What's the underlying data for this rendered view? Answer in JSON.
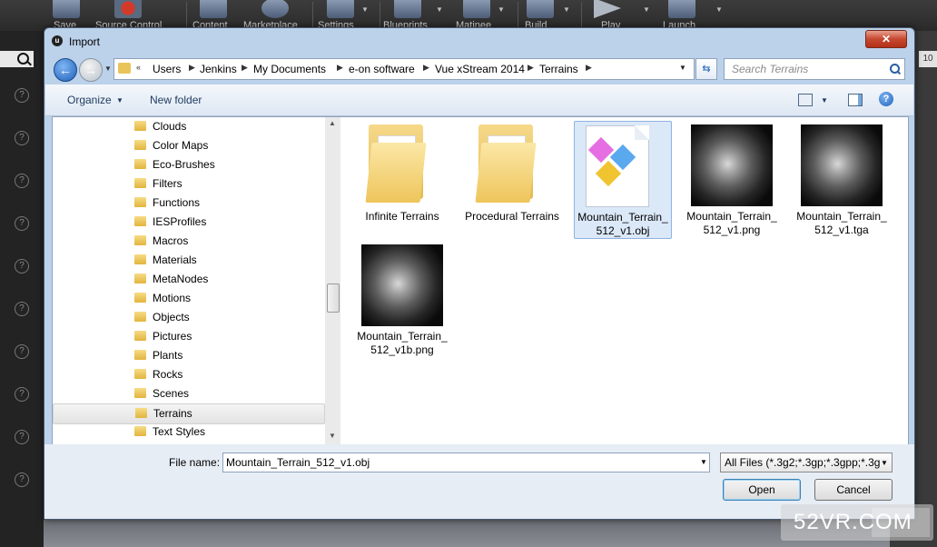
{
  "app_toolbar": {
    "items": [
      {
        "label": "Save"
      },
      {
        "label": "Source Control"
      },
      {
        "label": "Content"
      },
      {
        "label": "Marketplace"
      },
      {
        "label": "Settings"
      },
      {
        "label": "Blueprints"
      },
      {
        "label": "Matinee"
      },
      {
        "label": "Build"
      },
      {
        "label": "Play"
      },
      {
        "label": "Launch"
      }
    ],
    "right_value": "10"
  },
  "dialog": {
    "title": "Import",
    "close_glyph": "✕",
    "breadcrumbs": [
      "Users",
      "Jenkins",
      "My Documents",
      "e-on software",
      "Vue xStream 2014",
      "Terrains"
    ],
    "search_placeholder": "Search Terrains",
    "commands": {
      "organize": "Organize",
      "new_folder": "New folder"
    },
    "folders": [
      {
        "label": "Clouds"
      },
      {
        "label": "Color Maps"
      },
      {
        "label": "Eco-Brushes"
      },
      {
        "label": "Filters"
      },
      {
        "label": "Functions"
      },
      {
        "label": "IESProfiles"
      },
      {
        "label": "Macros"
      },
      {
        "label": "Materials"
      },
      {
        "label": "MetaNodes"
      },
      {
        "label": "Motions"
      },
      {
        "label": "Objects"
      },
      {
        "label": "Pictures"
      },
      {
        "label": "Plants"
      },
      {
        "label": "Rocks"
      },
      {
        "label": "Scenes"
      },
      {
        "label": "Terrains",
        "selected": true
      },
      {
        "label": "Text Styles"
      }
    ],
    "files": [
      {
        "name": "Infinite Terrains",
        "kind": "folder"
      },
      {
        "name": "Procedural Terrains",
        "kind": "folder"
      },
      {
        "name": "Mountain_Terrain_512_v1.obj",
        "kind": "obj",
        "selected": true
      },
      {
        "name": "Mountain_Terrain_512_v1.png",
        "kind": "image"
      },
      {
        "name": "Mountain_Terrain_512_v1.tga",
        "kind": "image"
      },
      {
        "name": "Mountain_Terrain_512_v1b.png",
        "kind": "image"
      }
    ],
    "file_name_label": "File name:",
    "file_name_value": "Mountain_Terrain_512_v1.obj",
    "filter_value": "All Files (*.3g2;*.3gp;*.3gpp;*.3g",
    "open_label": "Open",
    "cancel_label": "Cancel"
  },
  "watermark": {
    "text": "52VR.COM"
  },
  "colors": {
    "dialog_frame": "#bcd1ea",
    "selection": "#dbe8f8",
    "close_button": "#c74830"
  }
}
